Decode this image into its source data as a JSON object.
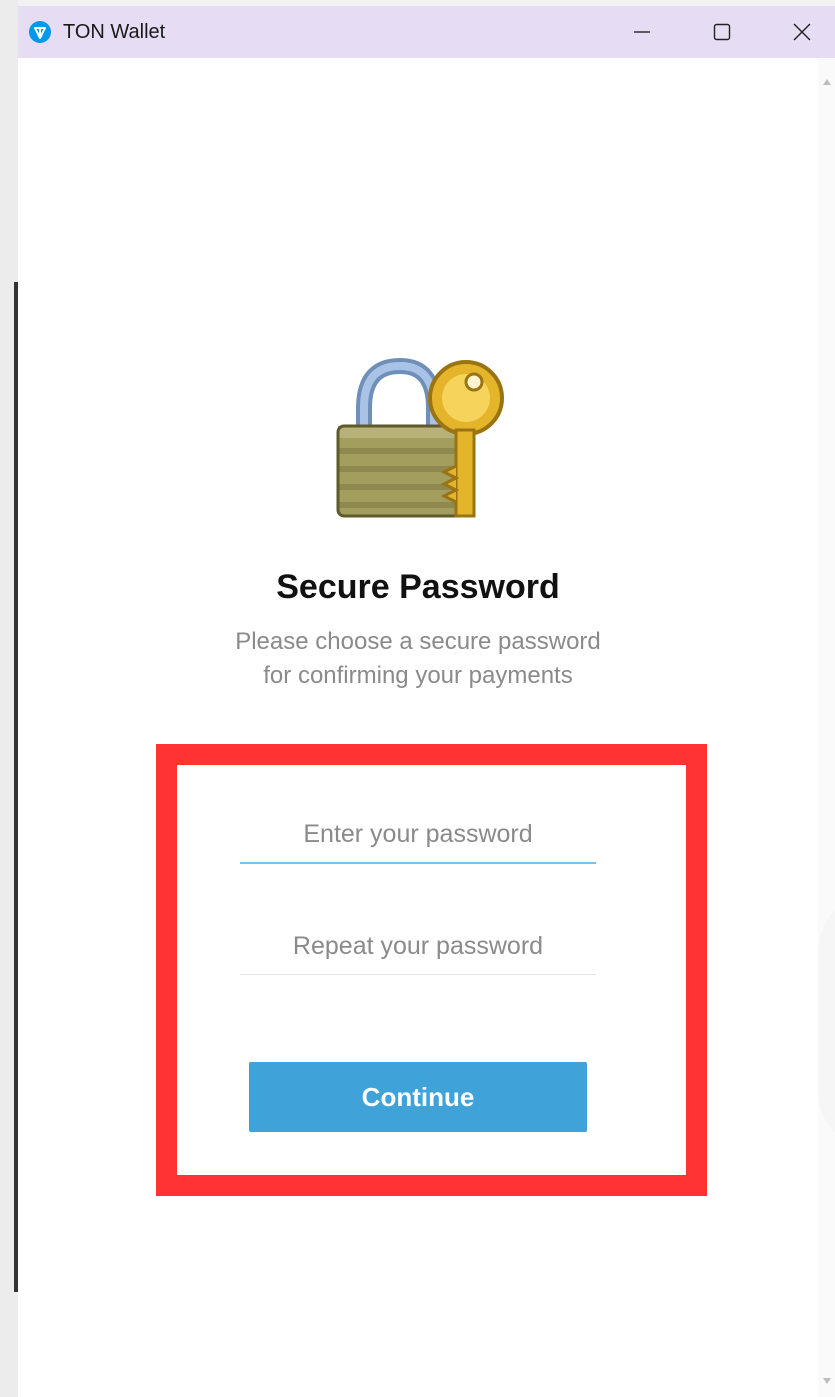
{
  "window": {
    "title": "TON Wallet",
    "logo_icon": "ton-diamond-icon",
    "controls": [
      "minimize-icon",
      "maximize-icon",
      "close-icon"
    ],
    "titlebar_color": "#e6dcf3"
  },
  "content": {
    "illustration": "lock-and-key-icon",
    "title": "Secure Password",
    "subtitle_line1": "Please choose a secure password",
    "subtitle_line2": "for confirming your payments"
  },
  "form": {
    "password_placeholder": "Enter your password",
    "repeat_placeholder": "Repeat your password",
    "password_value": "",
    "repeat_value": "",
    "continue_label": "Continue"
  },
  "colors": {
    "accent": "#3fa2d8",
    "highlight": "#ff3333"
  }
}
